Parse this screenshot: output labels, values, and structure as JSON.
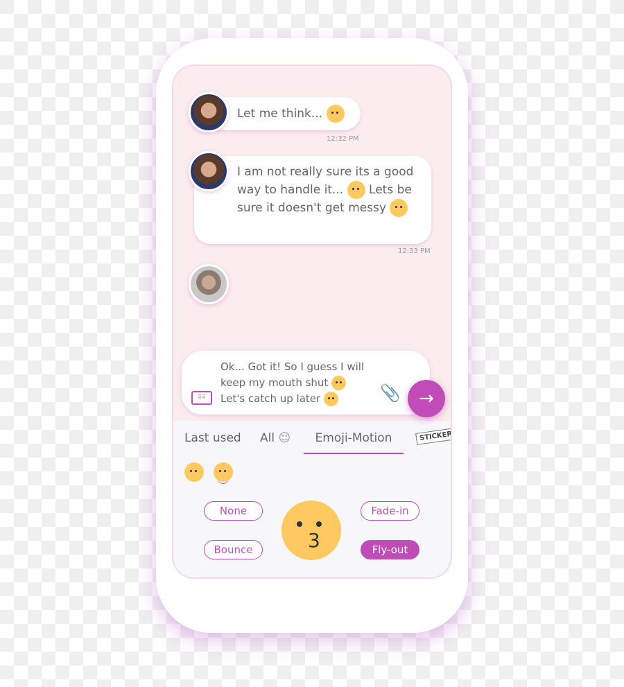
{
  "messages": [
    {
      "text": "Let me think...",
      "emoji": "neutral-face",
      "time": "12:32 PM"
    },
    {
      "text": "I am not really sure its a good way to handle it...",
      "emoji": "laughing-face",
      "text2": "Lets be sure it doesn't get messy",
      "emoji2": "crying-face",
      "time": "12:33 PM"
    }
  ],
  "composer": {
    "line1": "Ok... Got it! So I guess I will",
    "line2": "keep my mouth shut",
    "line3": "Let's catch up later"
  },
  "tabs": {
    "last_used": "Last used",
    "all": "All",
    "emoji_motion": "Emoji-Motion",
    "sticker": "STICKER"
  },
  "motion_options": {
    "none": "None",
    "fade_in": "Fade-in",
    "bounce": "Bounce",
    "fly_out": "Fly-out",
    "selected": "Fly-out"
  },
  "colors": {
    "accent": "#c04db7",
    "chat_bg": "#fbecee",
    "emoji": "#fdc960"
  }
}
